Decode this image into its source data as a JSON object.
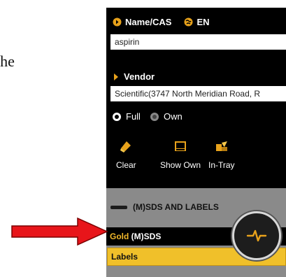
{
  "doc_fragment": "the",
  "header": {
    "name_cas_label": "Name/CAS",
    "language_label": "EN"
  },
  "search": {
    "value": "aspirin"
  },
  "vendor": {
    "heading": "Vendor",
    "value": "Scientific(3747 North Meridian Road, R"
  },
  "scope": {
    "options": [
      "Full",
      "Own"
    ],
    "selected": "Full"
  },
  "toolbar": {
    "clear_label": "Clear",
    "show_own_label": "Show Own",
    "in_tray_label": "In-Tray"
  },
  "sds_section": {
    "heading": "(M)SDS AND LABELS",
    "gold_prefix": "Gold",
    "gold_suffix": "(M)SDS",
    "labels_item": "Labels"
  },
  "colors": {
    "panel_bg": "#000000",
    "accent_gold": "#f0b72a",
    "lower_bg": "#8a8a8a",
    "arrow_red": "#e8151a"
  }
}
